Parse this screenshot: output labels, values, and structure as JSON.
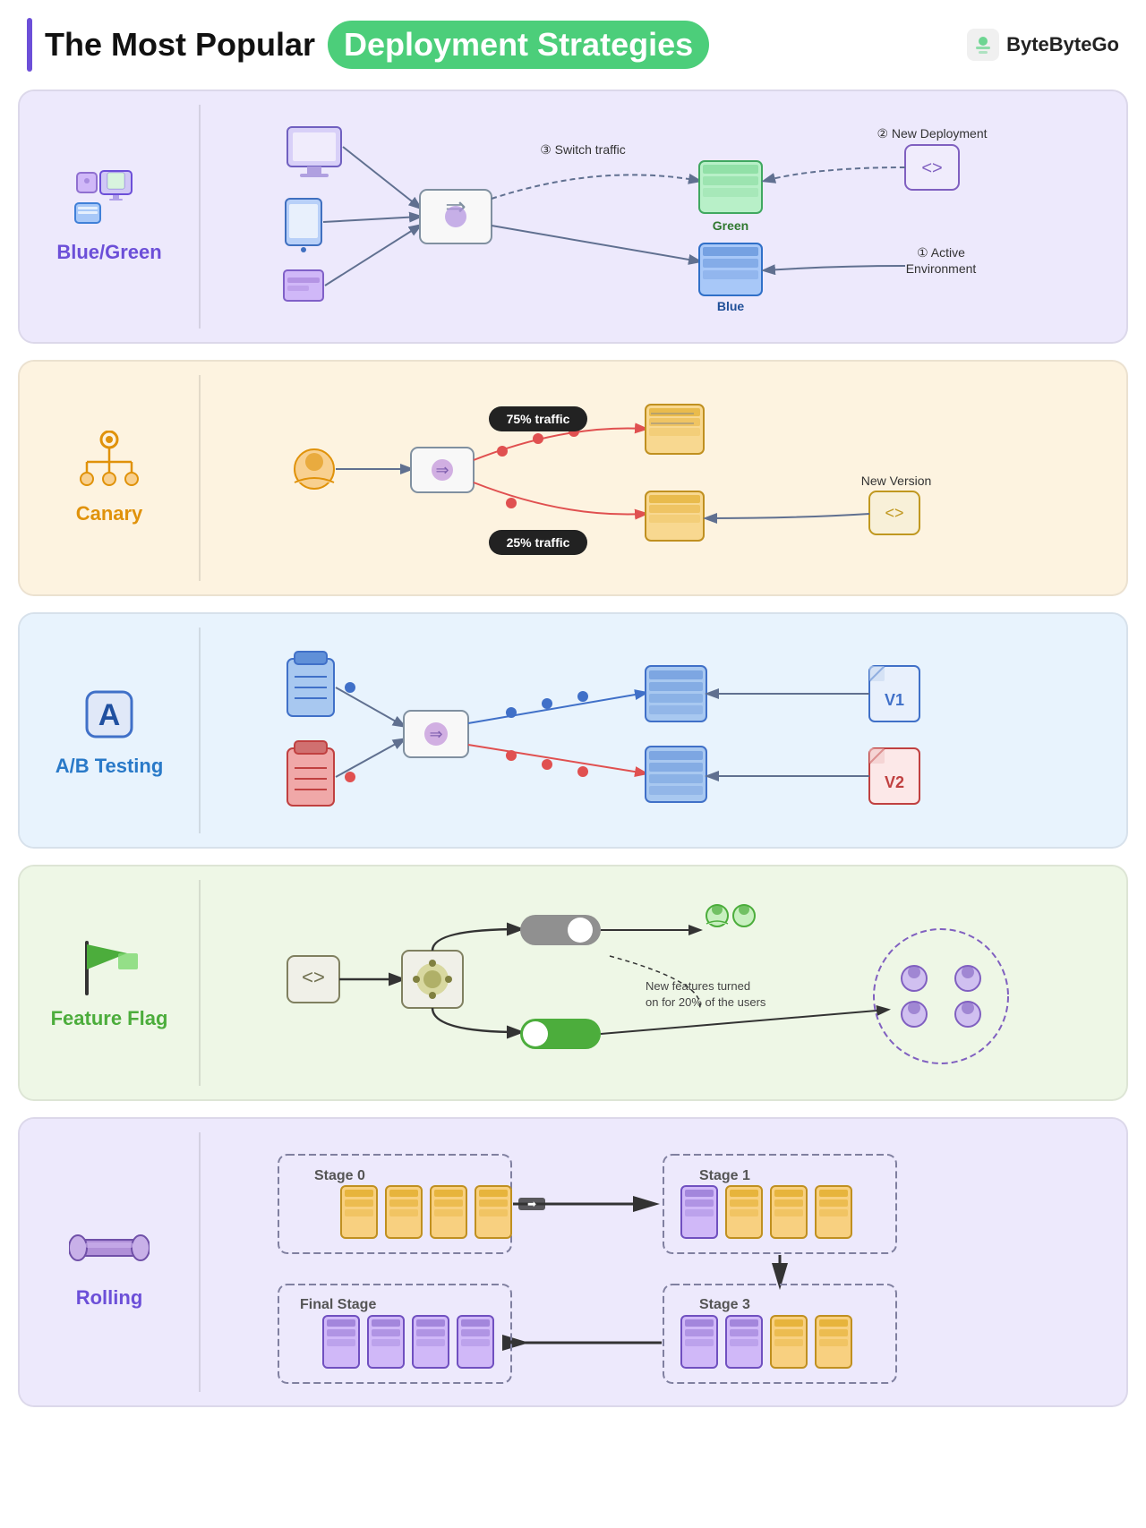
{
  "header": {
    "bar_color": "#6c4fd8",
    "title_plain": "The Most Popular",
    "title_highlight": "Deployment Strategies",
    "brand_name": "ByteByteGo"
  },
  "strategies": [
    {
      "id": "bluegreen",
      "label": "Blue/Green",
      "label_color": "#6c4fd8",
      "bg": "#ede9fc",
      "notes": [
        "Switch traffic",
        "New Deployment",
        "Active Environment"
      ],
      "steps": [
        "③ Switch traffic",
        "② New Deployment",
        "① Active Environment"
      ],
      "environments": [
        "Green",
        "Blue"
      ]
    },
    {
      "id": "canary",
      "label": "Canary",
      "label_color": "#e0920a",
      "bg": "#fdf3e0",
      "traffic": [
        "75% traffic",
        "25% traffic"
      ],
      "notes": [
        "New Version"
      ]
    },
    {
      "id": "ab",
      "label": "A/B Testing",
      "label_color": "#2979c8",
      "bg": "#e8f3fd",
      "versions": [
        "V1",
        "V2"
      ]
    },
    {
      "id": "featureflag",
      "label": "Feature Flag",
      "label_color": "#4cad3c",
      "bg": "#eef7e6",
      "note": "New features turned\non for 20% of the users"
    },
    {
      "id": "rolling",
      "label": "Rolling",
      "label_color": "#6c4fd8",
      "bg": "#ede9fc",
      "stages": [
        "Stage 0",
        "Stage 1",
        "Stage 3",
        "Final Stage"
      ]
    }
  ]
}
